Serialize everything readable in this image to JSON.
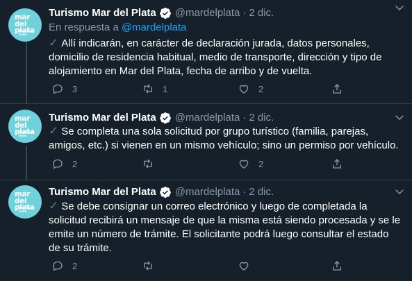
{
  "colors": {
    "background": "#15202b",
    "secondary_text": "#8899a6",
    "link": "#1da1f2",
    "avatar": "#6fd1dc"
  },
  "avatar": {
    "logo_text": "mar del plata",
    "logo_sub": "Tenemos todo"
  },
  "tweets": [
    {
      "name": "Turismo Mar del Plata",
      "handle": "@mardelplata",
      "dot": "·",
      "date": "2 dic.",
      "reply_prefix": "En respuesta a",
      "reply_mention": "@mardelplata",
      "check": "✓",
      "text": "Allí indicarán, en carácter de declaración jurada, datos personales, domicilio de residencia habitual, medio de transporte, dirección y tipo de alojamiento en Mar del Plata, fecha de arribo y de vuelta.",
      "replies": "3",
      "retweets": "1",
      "likes": "2"
    },
    {
      "name": "Turismo Mar del Plata",
      "handle": "@mardelplata",
      "dot": "·",
      "date": "2 dic.",
      "check": "✓",
      "text": "Se completa una sola solicitud por grupo turístico (familia, parejas, amigos, etc.) si vienen en un mismo vehículo; sino un permiso por vehículo.",
      "replies": "2",
      "retweets": "",
      "likes": "2"
    },
    {
      "name": "Turismo Mar del Plata",
      "handle": "@mardelplata",
      "dot": "·",
      "date": "2 dic.",
      "check": "✓",
      "text": "Se debe consignar un correo electrónico y luego de completada la solicitud recibirá un mensaje de que la misma está siendo procesada y se le emite un número de trámite. El solicitante podrá luego consultar el estado de su trámite.",
      "replies": "2",
      "retweets": "",
      "likes": ""
    }
  ]
}
